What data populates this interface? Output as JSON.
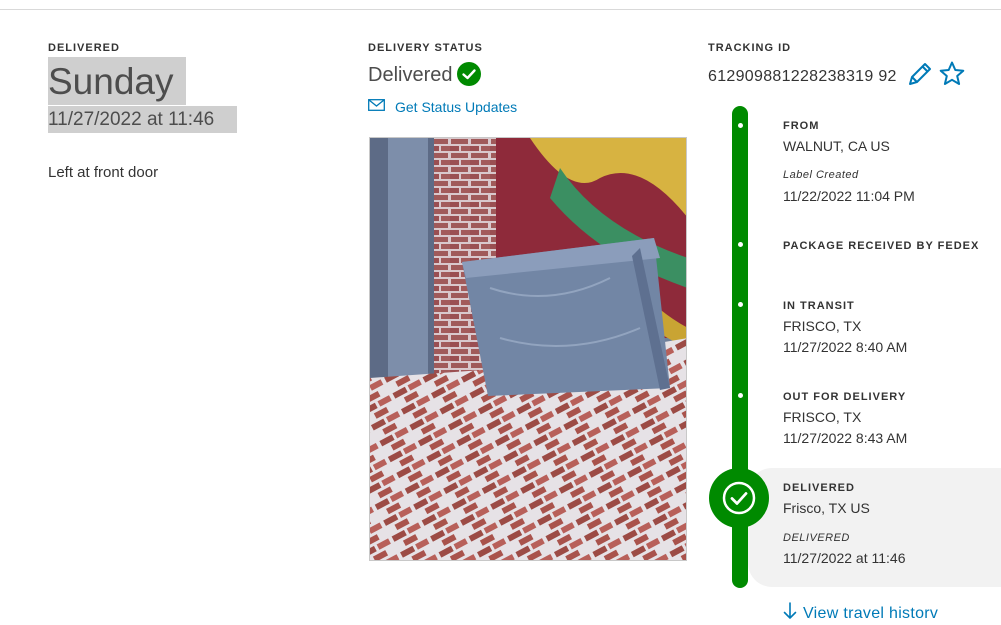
{
  "delivery": {
    "caption": "DELIVERED",
    "day": "Sunday",
    "datetime": "11/27/2022 at 11:46",
    "note": "Left at front door"
  },
  "status": {
    "caption": "DELIVERY STATUS",
    "value": "Delivered",
    "updates_link": "Get Status Updates"
  },
  "tracking": {
    "caption": "TRACKING ID",
    "number": "612909881228238319 92"
  },
  "timeline": {
    "events": [
      {
        "title": "FROM",
        "location": "WALNUT, CA US",
        "sub_label": "Label Created",
        "time": "11/22/2022 11:04 PM"
      },
      {
        "title": "PACKAGE RECEIVED BY FEDEX"
      },
      {
        "title": "IN TRANSIT",
        "location": "FRISCO, TX",
        "time": "11/27/2022 8:40 AM"
      },
      {
        "title": "OUT FOR DELIVERY",
        "location": "FRISCO, TX",
        "time": "11/27/2022 8:43 AM"
      },
      {
        "title": "DELIVERED",
        "location": "Frisco, TX US",
        "sub_label": "DELIVERED",
        "time": "11/27/2022 at 11:46"
      }
    ],
    "view_history": "View travel historv"
  },
  "colors": {
    "accent_green": "#008a00",
    "link_blue": "#007ab7",
    "highlight_gray": "#cfcfcf"
  },
  "icons": [
    "checkmark-circle-icon",
    "envelope-icon",
    "pencil-icon",
    "star-icon",
    "arrow-down-icon"
  ]
}
